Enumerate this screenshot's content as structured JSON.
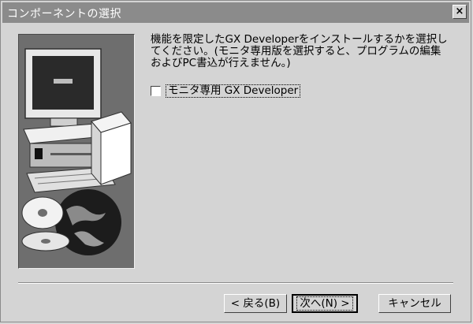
{
  "window": {
    "title": "コンポーネントの選択",
    "close_glyph": "×"
  },
  "content": {
    "description": "機能を限定したGX Developerをインストールするかを選択してください。(モニタ専用版を選択すると、プログラムの編集およびPC書込が行えません。)",
    "option_label": "モニタ専用 GX Developer",
    "option_checked": false
  },
  "buttons": {
    "back": "< 戻る(B)",
    "next": "次へ(N) >",
    "cancel": "キャンセル"
  },
  "icons": {
    "art": "computer-with-cds-and-globe"
  }
}
